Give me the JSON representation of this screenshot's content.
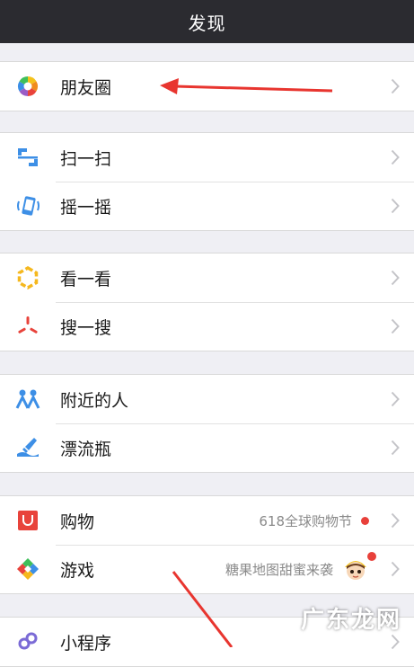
{
  "header": {
    "title": "发现"
  },
  "groups": [
    {
      "items": [
        {
          "label": "朋友圈",
          "icon": "moments-aperture-icon"
        }
      ]
    },
    {
      "items": [
        {
          "label": "扫一扫",
          "icon": "scan-icon"
        },
        {
          "label": "摇一摇",
          "icon": "shake-phone-icon"
        }
      ]
    },
    {
      "items": [
        {
          "label": "看一看",
          "icon": "top-stories-icon"
        },
        {
          "label": "搜一搜",
          "icon": "search-sparkle-icon"
        }
      ]
    },
    {
      "items": [
        {
          "label": "附近的人",
          "icon": "people-nearby-icon"
        },
        {
          "label": "漂流瓶",
          "icon": "drift-bottle-icon"
        }
      ]
    },
    {
      "items": [
        {
          "label": "购物",
          "icon": "shopping-bag-icon",
          "extra": "618全球购物节"
        },
        {
          "label": "游戏",
          "icon": "games-icon",
          "extra": "糖果地图甜蜜来袭"
        }
      ]
    },
    {
      "items": [
        {
          "label": "小程序",
          "icon": "mini-programs-icon"
        }
      ]
    }
  ],
  "watermark": "广东龙网",
  "colors": {
    "navbar": "#2b2b30",
    "background": "#efeff4",
    "annotation_arrow": "#e8352f",
    "badge": "#e8403a"
  }
}
